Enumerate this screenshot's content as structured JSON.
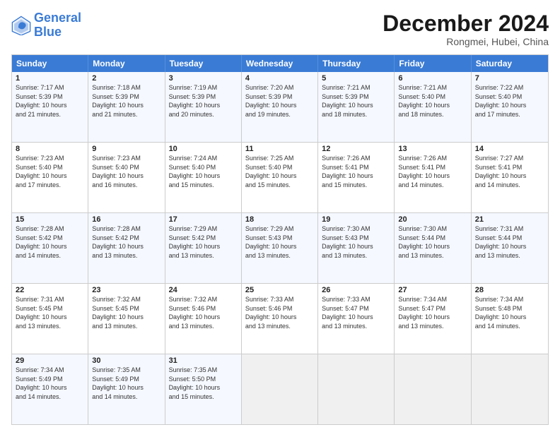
{
  "logo": {
    "general": "General",
    "blue": "Blue"
  },
  "header": {
    "title": "December 2024",
    "subtitle": "Rongmei, Hubei, China"
  },
  "weekdays": [
    "Sunday",
    "Monday",
    "Tuesday",
    "Wednesday",
    "Thursday",
    "Friday",
    "Saturday"
  ],
  "rows": [
    [
      {
        "day": "1",
        "info": "Sunrise: 7:17 AM\nSunset: 5:39 PM\nDaylight: 10 hours\nand 21 minutes."
      },
      {
        "day": "2",
        "info": "Sunrise: 7:18 AM\nSunset: 5:39 PM\nDaylight: 10 hours\nand 21 minutes."
      },
      {
        "day": "3",
        "info": "Sunrise: 7:19 AM\nSunset: 5:39 PM\nDaylight: 10 hours\nand 20 minutes."
      },
      {
        "day": "4",
        "info": "Sunrise: 7:20 AM\nSunset: 5:39 PM\nDaylight: 10 hours\nand 19 minutes."
      },
      {
        "day": "5",
        "info": "Sunrise: 7:21 AM\nSunset: 5:39 PM\nDaylight: 10 hours\nand 18 minutes."
      },
      {
        "day": "6",
        "info": "Sunrise: 7:21 AM\nSunset: 5:40 PM\nDaylight: 10 hours\nand 18 minutes."
      },
      {
        "day": "7",
        "info": "Sunrise: 7:22 AM\nSunset: 5:40 PM\nDaylight: 10 hours\nand 17 minutes."
      }
    ],
    [
      {
        "day": "8",
        "info": "Sunrise: 7:23 AM\nSunset: 5:40 PM\nDaylight: 10 hours\nand 17 minutes."
      },
      {
        "day": "9",
        "info": "Sunrise: 7:23 AM\nSunset: 5:40 PM\nDaylight: 10 hours\nand 16 minutes."
      },
      {
        "day": "10",
        "info": "Sunrise: 7:24 AM\nSunset: 5:40 PM\nDaylight: 10 hours\nand 15 minutes."
      },
      {
        "day": "11",
        "info": "Sunrise: 7:25 AM\nSunset: 5:40 PM\nDaylight: 10 hours\nand 15 minutes."
      },
      {
        "day": "12",
        "info": "Sunrise: 7:26 AM\nSunset: 5:41 PM\nDaylight: 10 hours\nand 15 minutes."
      },
      {
        "day": "13",
        "info": "Sunrise: 7:26 AM\nSunset: 5:41 PM\nDaylight: 10 hours\nand 14 minutes."
      },
      {
        "day": "14",
        "info": "Sunrise: 7:27 AM\nSunset: 5:41 PM\nDaylight: 10 hours\nand 14 minutes."
      }
    ],
    [
      {
        "day": "15",
        "info": "Sunrise: 7:28 AM\nSunset: 5:42 PM\nDaylight: 10 hours\nand 14 minutes."
      },
      {
        "day": "16",
        "info": "Sunrise: 7:28 AM\nSunset: 5:42 PM\nDaylight: 10 hours\nand 13 minutes."
      },
      {
        "day": "17",
        "info": "Sunrise: 7:29 AM\nSunset: 5:42 PM\nDaylight: 10 hours\nand 13 minutes."
      },
      {
        "day": "18",
        "info": "Sunrise: 7:29 AM\nSunset: 5:43 PM\nDaylight: 10 hours\nand 13 minutes."
      },
      {
        "day": "19",
        "info": "Sunrise: 7:30 AM\nSunset: 5:43 PM\nDaylight: 10 hours\nand 13 minutes."
      },
      {
        "day": "20",
        "info": "Sunrise: 7:30 AM\nSunset: 5:44 PM\nDaylight: 10 hours\nand 13 minutes."
      },
      {
        "day": "21",
        "info": "Sunrise: 7:31 AM\nSunset: 5:44 PM\nDaylight: 10 hours\nand 13 minutes."
      }
    ],
    [
      {
        "day": "22",
        "info": "Sunrise: 7:31 AM\nSunset: 5:45 PM\nDaylight: 10 hours\nand 13 minutes."
      },
      {
        "day": "23",
        "info": "Sunrise: 7:32 AM\nSunset: 5:45 PM\nDaylight: 10 hours\nand 13 minutes."
      },
      {
        "day": "24",
        "info": "Sunrise: 7:32 AM\nSunset: 5:46 PM\nDaylight: 10 hours\nand 13 minutes."
      },
      {
        "day": "25",
        "info": "Sunrise: 7:33 AM\nSunset: 5:46 PM\nDaylight: 10 hours\nand 13 minutes."
      },
      {
        "day": "26",
        "info": "Sunrise: 7:33 AM\nSunset: 5:47 PM\nDaylight: 10 hours\nand 13 minutes."
      },
      {
        "day": "27",
        "info": "Sunrise: 7:34 AM\nSunset: 5:47 PM\nDaylight: 10 hours\nand 13 minutes."
      },
      {
        "day": "28",
        "info": "Sunrise: 7:34 AM\nSunset: 5:48 PM\nDaylight: 10 hours\nand 14 minutes."
      }
    ],
    [
      {
        "day": "29",
        "info": "Sunrise: 7:34 AM\nSunset: 5:49 PM\nDaylight: 10 hours\nand 14 minutes."
      },
      {
        "day": "30",
        "info": "Sunrise: 7:35 AM\nSunset: 5:49 PM\nDaylight: 10 hours\nand 14 minutes."
      },
      {
        "day": "31",
        "info": "Sunrise: 7:35 AM\nSunset: 5:50 PM\nDaylight: 10 hours\nand 15 minutes."
      },
      {
        "day": "",
        "info": ""
      },
      {
        "day": "",
        "info": ""
      },
      {
        "day": "",
        "info": ""
      },
      {
        "day": "",
        "info": ""
      }
    ]
  ]
}
